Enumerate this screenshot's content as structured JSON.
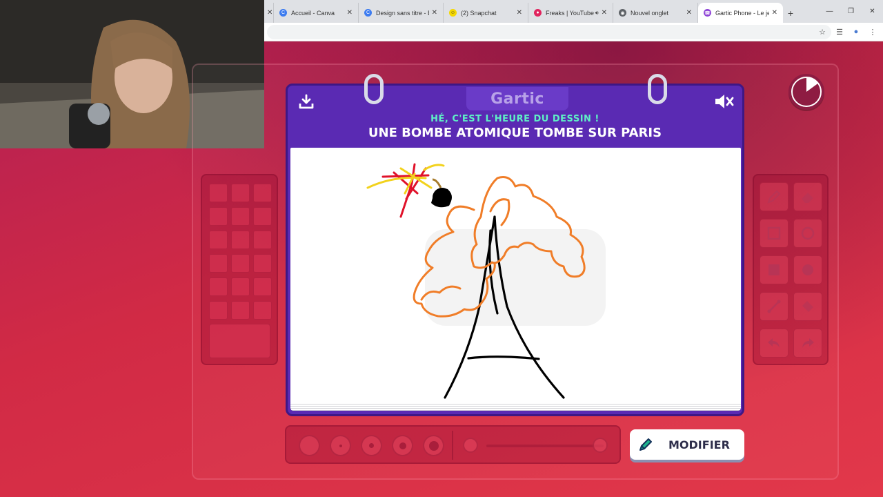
{
  "browser": {
    "tabs": [
      {
        "title": "Accueil - Canva",
        "favicon_color": "#3d7cf0",
        "favicon_glyph": "C",
        "icon": "canva-icon"
      },
      {
        "title": "Design sans titre - Ba",
        "favicon_color": "#3d7cf0",
        "favicon_glyph": "C",
        "icon": "canva-icon"
      },
      {
        "title": "(2) Snapchat",
        "favicon_color": "#f5d800",
        "favicon_glyph": "☺",
        "icon": "snapchat-icon"
      },
      {
        "title": "Freaks | YouTube",
        "favicon_color": "#e0245e",
        "favicon_glyph": "●",
        "icon": "youtube-icon",
        "audio": true
      },
      {
        "title": "Nouvel onglet",
        "favicon_color": "#5f6368",
        "favicon_glyph": "◉",
        "icon": "chrome-icon"
      },
      {
        "title": "Gartic Phone - Le jeu",
        "favicon_color": "#8e44d6",
        "favicon_glyph": "☎",
        "icon": "gartic-icon",
        "active": true
      }
    ],
    "new_tab_glyph": "+",
    "close_glyph": "✕",
    "window_controls": {
      "minimize": "—",
      "restore": "❐",
      "close": "✕"
    },
    "toolbar_icons": {
      "bookmark": "☆",
      "reading_list": "☰",
      "profile": "●",
      "menu": "⋮"
    }
  },
  "game": {
    "logo": "Gartic",
    "subtitle": "HÉ, C'EST L'HEURE DU DESSIN !",
    "prompt": "UNE BOMBE ATOMIQUE TOMBE SUR PARIS",
    "modify_label": "MODIFIER",
    "timer_remaining_fraction": 0.85,
    "colors": {
      "notebook": "#5a2ab3",
      "subtitle": "#5ff0c6",
      "stroke_black": "#000000",
      "stroke_orange": "#f07d28",
      "stroke_red": "#e0122a",
      "stroke_yellow": "#f2d21c",
      "stroke_fuse": "#a67a2a"
    },
    "tools": [
      "pencil-icon",
      "eraser-icon",
      "rectangle-outline-icon",
      "circle-outline-icon",
      "rectangle-fill-icon",
      "circle-fill-icon",
      "line-icon",
      "bucket-icon",
      "undo-icon",
      "redo-icon"
    ]
  }
}
